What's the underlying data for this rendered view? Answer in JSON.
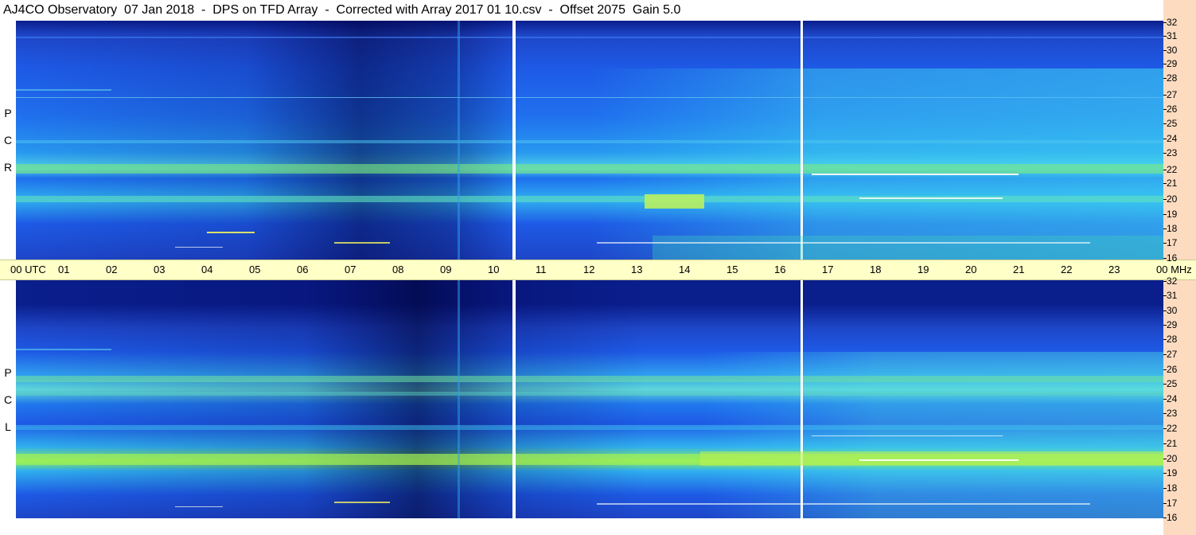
{
  "header": {
    "title": "AJ4CO Observatory  07 Jan 2018  -  DPS on TFD Array  -  Corrected with Array 2017 01 10.csv  -  Offset 2075  Gain 5.0"
  },
  "panels": {
    "rcp": {
      "label_letters": [
        "P",
        "C",
        "R"
      ]
    },
    "lcp": {
      "label_letters": [
        "P",
        "C",
        "L"
      ]
    }
  },
  "time_axis": {
    "labels": [
      "00 UTC",
      "01",
      "02",
      "03",
      "04",
      "05",
      "06",
      "07",
      "08",
      "09",
      "10",
      "11",
      "12",
      "13",
      "14",
      "15",
      "16",
      "17",
      "18",
      "19",
      "20",
      "21",
      "22",
      "23",
      "00 MHz"
    ]
  },
  "freq_axis": {
    "labels": [
      "32",
      "31",
      "30",
      "29",
      "28",
      "27",
      "26",
      "25",
      "24",
      "23",
      "22",
      "21",
      "20",
      "19",
      "18",
      "17",
      "16"
    ]
  },
  "colors": {
    "dark_blue": "#0a1e8c",
    "mid_blue": "#1e5ae6",
    "cyan": "#19b4f0",
    "green": "#8cf050",
    "axis_bg": "#ffffc8",
    "right_strip": "#fddbc0"
  }
}
